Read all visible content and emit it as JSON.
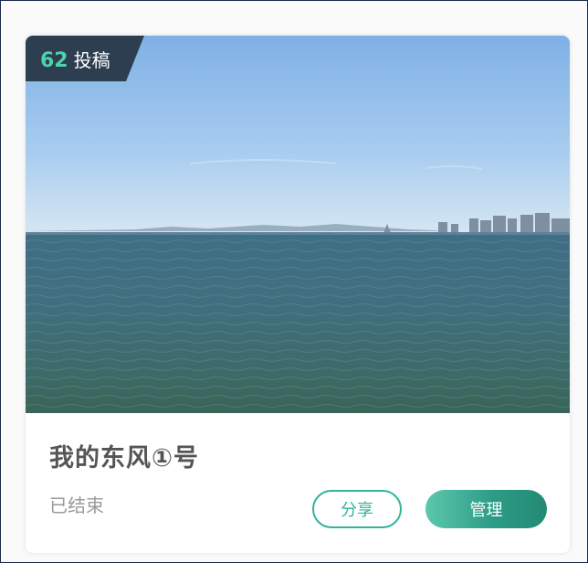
{
  "badge": {
    "count": "62",
    "label": "投稿"
  },
  "card": {
    "title": "我的东风①号",
    "status": "已结束"
  },
  "actions": {
    "share_label": "分享",
    "manage_label": "管理"
  },
  "colors": {
    "accent": "#33b39a",
    "badge_bg": "#2c3e50"
  }
}
